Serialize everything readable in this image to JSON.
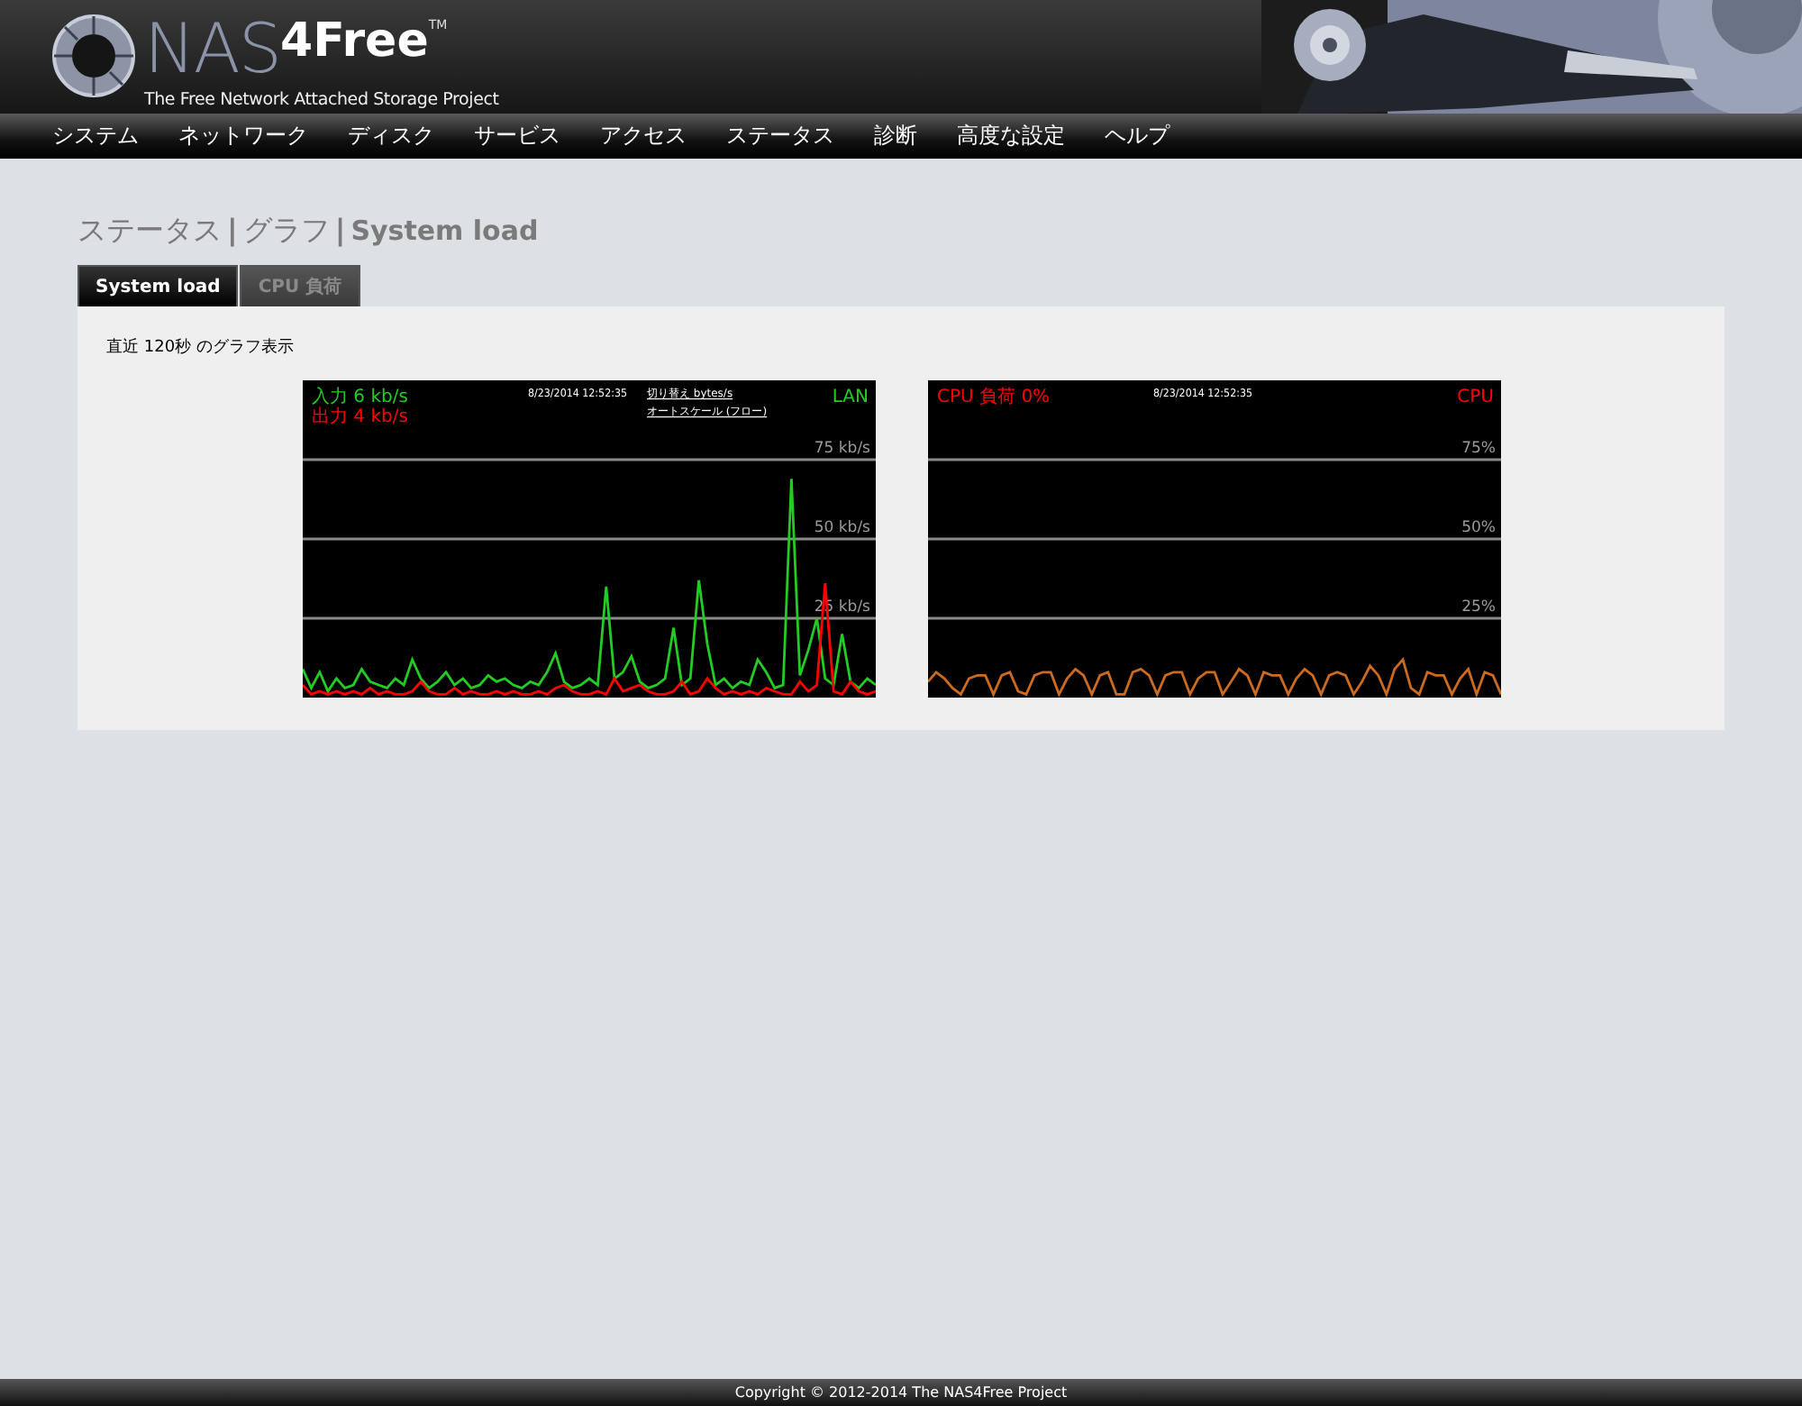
{
  "header": {
    "logo_main": "NAS",
    "logo_accent": "4Free",
    "logo_tm": "TM",
    "tagline": "The Free Network Attached Storage Project"
  },
  "nav": [
    "システム",
    "ネットワーク",
    "ディスク",
    "サービス",
    "アクセス",
    "ステータス",
    "診断",
    "高度な設定",
    "ヘルプ"
  ],
  "breadcrumb": [
    {
      "kind": "item",
      "text": "ステータス"
    },
    {
      "kind": "separator",
      "text": "|"
    },
    {
      "kind": "item",
      "text": "グラフ"
    },
    {
      "kind": "separator",
      "text": "|"
    },
    {
      "kind": "current",
      "text": "System load"
    }
  ],
  "tabs": [
    {
      "label": "System load",
      "selected": true
    },
    {
      "label": "CPU 負荷",
      "selected": false
    }
  ],
  "description": "直近 120秒 のグラフ表示",
  "graphs": [
    {
      "legend": [
        {
          "text": "入力 6 kb/s",
          "color": "#22cc22"
        },
        {
          "text": "出力 4 kb/s",
          "color": "#ff0000"
        }
      ],
      "timestamp": "8/23/2014 12:52:35",
      "links": [
        "切り替え bytes/s",
        "オートスケール (フロー)"
      ],
      "corner_label": "LAN",
      "chart_data": {
        "type": "line",
        "grid": true,
        "ylim": [
          0,
          100
        ],
        "yticks": [
          {
            "value": 25,
            "label": "25 kb/s"
          },
          {
            "value": 50,
            "label": "50 kb/s"
          },
          {
            "value": 75,
            "label": "75 kb/s"
          }
        ],
        "series": [
          {
            "color": "#22cc22",
            "values": [
              9,
              3,
              8,
              2,
              6,
              3,
              4,
              9,
              5,
              4,
              3,
              6,
              4,
              12,
              6,
              3,
              5,
              8,
              4,
              6,
              3,
              4,
              7,
              5,
              6,
              4,
              3,
              5,
              4,
              8,
              14,
              5,
              3,
              4,
              6,
              4,
              35,
              6,
              8,
              13,
              5,
              3,
              4,
              6,
              22,
              4,
              6,
              37,
              17,
              4,
              6,
              3,
              5,
              4,
              12,
              8,
              3,
              4,
              69,
              7,
              15,
              25,
              6,
              4,
              20,
              5,
              3,
              6,
              4
            ]
          },
          {
            "color": "#ff0000",
            "values": [
              4,
              1,
              2,
              1,
              2,
              1,
              2,
              1,
              3,
              1,
              2,
              1,
              1,
              2,
              5,
              2,
              1,
              1,
              3,
              1,
              2,
              1,
              1,
              2,
              1,
              2,
              1,
              1,
              2,
              1,
              3,
              4,
              2,
              1,
              1,
              2,
              1,
              6,
              2,
              3,
              4,
              2,
              1,
              1,
              2,
              5,
              1,
              2,
              6,
              3,
              1,
              2,
              1,
              2,
              1,
              3,
              2,
              1,
              1,
              5,
              2,
              4,
              36,
              2,
              1,
              5,
              2,
              1,
              2
            ]
          }
        ]
      }
    },
    {
      "legend": [
        {
          "text": "CPU 負荷 0%",
          "color": "#ff0000"
        }
      ],
      "timestamp": "8/23/2014 12:52:35",
      "corner_label": "CPU",
      "chart_data": {
        "type": "line",
        "grid": true,
        "ylim": [
          0,
          100
        ],
        "yticks": [
          {
            "value": 25,
            "label": "25%"
          },
          {
            "value": 50,
            "label": "50%"
          },
          {
            "value": 75,
            "label": "75%"
          }
        ],
        "series": [
          {
            "color": "#cc6a1e",
            "values": [
              5,
              8,
              6,
              3,
              1,
              6,
              7,
              7,
              1,
              7,
              8,
              2,
              1,
              7,
              8,
              8,
              1,
              6,
              9,
              7,
              1,
              7,
              8,
              1,
              1,
              8,
              9,
              7,
              1,
              7,
              8,
              8,
              1,
              6,
              8,
              8,
              1,
              5,
              9,
              7,
              1,
              8,
              7,
              7,
              1,
              6,
              9,
              7,
              1,
              7,
              8,
              7,
              1,
              5,
              10,
              7,
              1,
              9,
              12,
              3,
              1,
              8,
              7,
              7,
              1,
              6,
              9,
              1,
              8,
              7,
              1
            ]
          }
        ]
      }
    }
  ],
  "footer": "Copyright © 2012-2014 The NAS4Free Project"
}
